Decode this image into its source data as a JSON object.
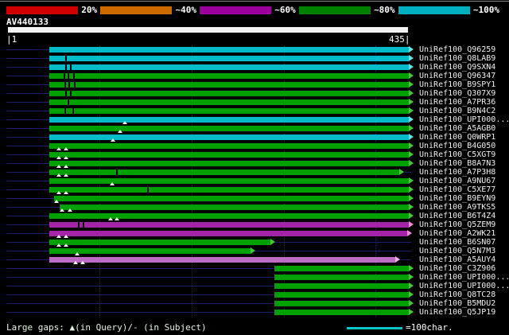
{
  "scalebar": {
    "segments": [
      {
        "label": "20%",
        "color": "#d00000"
      },
      {
        "label": "~40%",
        "color": "#cc6a00"
      },
      {
        "label": "~60%",
        "color": "#9c009c"
      },
      {
        "label": "~80%",
        "color": "#008000"
      },
      {
        "label": "~100%",
        "color": "#00b0c0"
      }
    ]
  },
  "query": {
    "name": "AV440133",
    "length": 435,
    "start_label": "|1",
    "end_label": "435|"
  },
  "palette": {
    "cyan": {
      "bar": "#00bcc8",
      "arrow": "#66e2e2"
    },
    "green": {
      "bar": "#00a000",
      "arrow": "#46c838"
    },
    "magenta": {
      "bar": "#a424a8",
      "arrow": "#f08cd8"
    },
    "violet": {
      "bar": "#bd6cc6",
      "arrow": "#f8aee8"
    }
  },
  "grid": {
    "interval_chars": 100,
    "positions": [
      100,
      200,
      300,
      400
    ]
  },
  "chart_data": {
    "type": "bar",
    "orientation": "horizontal",
    "title": "AV440133",
    "x_range": [
      1,
      435
    ],
    "rows": [
      {
        "label": "UniRef100_Q96259",
        "color": "cyan",
        "start": 46,
        "end": 435,
        "arrow": true,
        "ticks": [],
        "gaps": []
      },
      {
        "label": "UniRef100_Q8LAB9",
        "color": "cyan",
        "start": 46,
        "end": 435,
        "arrow": true,
        "ticks": [
          63
        ],
        "gaps": []
      },
      {
        "label": "UniRef100_Q9SXN4",
        "color": "cyan",
        "start": 46,
        "end": 435,
        "arrow": true,
        "ticks": [
          63,
          68
        ],
        "gaps": []
      },
      {
        "label": "UniRef100_Q96347",
        "color": "green",
        "start": 46,
        "end": 435,
        "arrow": true,
        "ticks": [
          61,
          66,
          72
        ],
        "gaps": []
      },
      {
        "label": "UniRef100_B9SPY1",
        "color": "green",
        "start": 46,
        "end": 435,
        "arrow": true,
        "ticks": [
          62,
          67,
          73
        ],
        "gaps": []
      },
      {
        "label": "UniRef100_Q307X9",
        "color": "green",
        "start": 46,
        "end": 435,
        "arrow": true,
        "ticks": [
          63,
          68
        ],
        "gaps": []
      },
      {
        "label": "UniRef100_A7PR36",
        "color": "green",
        "start": 46,
        "end": 435,
        "arrow": true,
        "ticks": [
          66
        ],
        "gaps": []
      },
      {
        "label": "UniRef100_B9N4C2",
        "color": "green",
        "start": 46,
        "end": 435,
        "arrow": true,
        "ticks": [
          62,
          71
        ],
        "gaps": []
      },
      {
        "label": "UniRef100_UPI000...",
        "color": "cyan",
        "start": 46,
        "end": 435,
        "arrow": true,
        "ticks": [],
        "gaps": [
          128
        ]
      },
      {
        "label": "UniRef100_A5AGB0",
        "color": "green",
        "start": 46,
        "end": 435,
        "arrow": true,
        "ticks": [],
        "gaps": [
          123
        ]
      },
      {
        "label": "UniRef100_Q0WRP1",
        "color": "cyan",
        "start": 46,
        "end": 435,
        "arrow": true,
        "ticks": [],
        "gaps": [
          115
        ]
      },
      {
        "label": "UniRef100_B4G050",
        "color": "green",
        "start": 46,
        "end": 435,
        "arrow": true,
        "ticks": [],
        "gaps": [
          56,
          64
        ]
      },
      {
        "label": "UniRef100_C5XGT9",
        "color": "green",
        "start": 46,
        "end": 435,
        "arrow": true,
        "ticks": [],
        "gaps": [
          56,
          64
        ]
      },
      {
        "label": "UniRef100_B8A7N3",
        "color": "green",
        "start": 46,
        "end": 435,
        "arrow": true,
        "ticks": [],
        "gaps": [
          56,
          64
        ]
      },
      {
        "label": "UniRef100_A7P3H8",
        "color": "green",
        "start": 46,
        "end": 425,
        "arrow": true,
        "ticks": [
          118
        ],
        "gaps": [
          56,
          64
        ]
      },
      {
        "label": "UniRef100_A9NU67",
        "color": "green",
        "start": 46,
        "end": 435,
        "arrow": true,
        "ticks": [],
        "gaps": [
          114
        ]
      },
      {
        "label": "UniRef100_C5XE77",
        "color": "green",
        "start": 46,
        "end": 435,
        "arrow": true,
        "ticks": [
          152
        ],
        "gaps": [
          56,
          64
        ]
      },
      {
        "label": "UniRef100_B9EYN9",
        "color": "green",
        "start": 51,
        "end": 435,
        "arrow": true,
        "ticks": [],
        "gaps": [
          54
        ]
      },
      {
        "label": "UniRef100_A9TKS5",
        "color": "green",
        "start": 57,
        "end": 435,
        "arrow": true,
        "ticks": [],
        "gaps": [
          60,
          68
        ]
      },
      {
        "label": "UniRef100_B6T4Z4",
        "color": "green",
        "start": 46,
        "end": 435,
        "arrow": true,
        "ticks": [],
        "gaps": [
          112,
          119
        ]
      },
      {
        "label": "UniRef100_Q5ZEM9",
        "color": "magenta",
        "start": 46,
        "end": 435,
        "arrow": true,
        "ticks": [
          77,
          82
        ],
        "gaps": []
      },
      {
        "label": "UniRef100_A2WK21",
        "color": "magenta",
        "start": 46,
        "end": 433,
        "arrow": true,
        "ticks": [],
        "gaps": [
          56,
          64
        ]
      },
      {
        "label": "UniRef100_B6SN07",
        "color": "green",
        "start": 46,
        "end": 285,
        "arrow": true,
        "ticks": [],
        "gaps": [
          56,
          64
        ]
      },
      {
        "label": "UniRef100_Q5N7M3",
        "color": "green",
        "start": 46,
        "end": 263,
        "arrow": true,
        "ticks": [],
        "gaps": [
          76
        ]
      },
      {
        "label": "UniRef100_A5AUY4",
        "color": "violet",
        "start": 46,
        "end": 420,
        "arrow": true,
        "ticks": [],
        "gaps": [
          74,
          82
        ]
      },
      {
        "label": "UniRef100_C3Z906",
        "color": "green",
        "start": 290,
        "end": 435,
        "arrow": true,
        "ticks": [],
        "gaps": []
      },
      {
        "label": "UniRef100_UPI000...",
        "color": "green",
        "start": 290,
        "end": 435,
        "arrow": true,
        "ticks": [],
        "gaps": []
      },
      {
        "label": "UniRef100_UPI000...",
        "color": "green",
        "start": 290,
        "end": 435,
        "arrow": true,
        "ticks": [],
        "gaps": []
      },
      {
        "label": "UniRef100_Q8TC28",
        "color": "green",
        "start": 290,
        "end": 435,
        "arrow": true,
        "ticks": [],
        "gaps": []
      },
      {
        "label": "UniRef100_B5MDU2",
        "color": "green",
        "start": 290,
        "end": 435,
        "arrow": true,
        "ticks": [],
        "gaps": []
      },
      {
        "label": "UniRef100_Q5JP19",
        "color": "green",
        "start": 290,
        "end": 435,
        "arrow": true,
        "ticks": [],
        "gaps": []
      }
    ]
  },
  "footer": {
    "gaps_label": "Large gaps: ▲(in Query)/- (in Subject)",
    "scale_label": "=100char."
  }
}
